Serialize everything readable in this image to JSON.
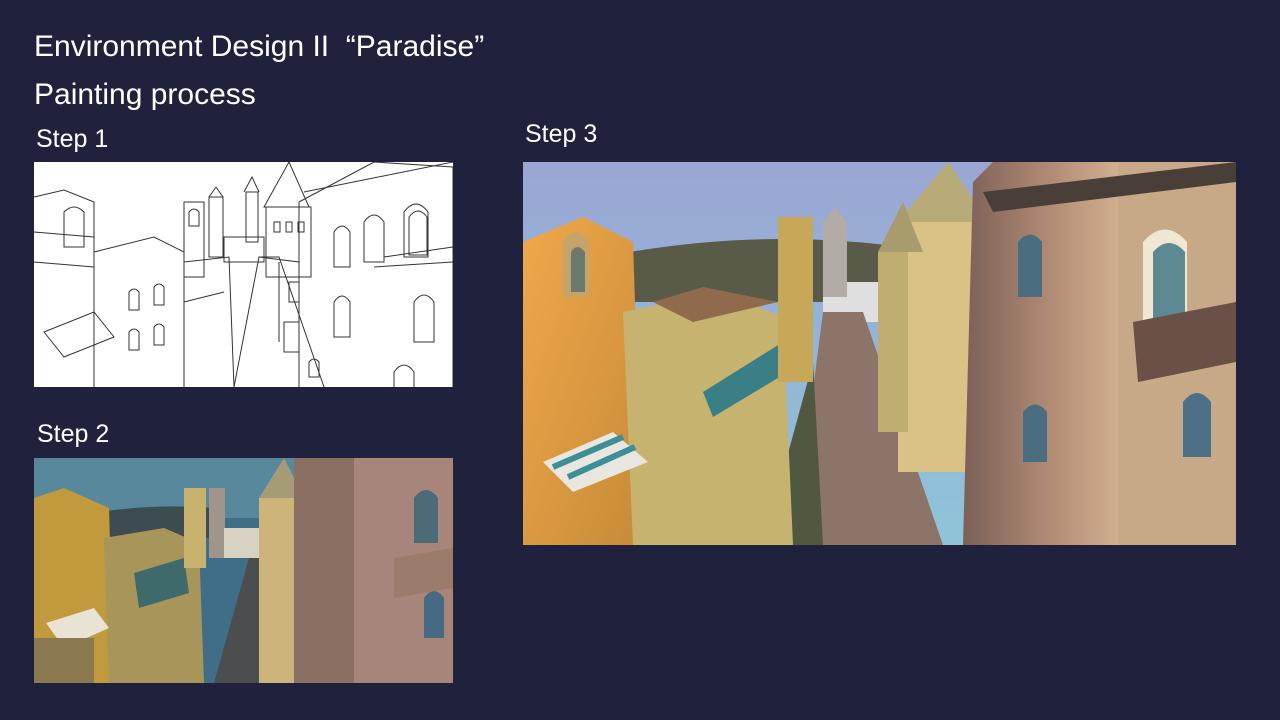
{
  "slide": {
    "title": "Environment Design II  “Paradise”",
    "subtitle": "Painting process"
  },
  "steps": [
    {
      "label": "Step 1"
    },
    {
      "label": "Step 2"
    },
    {
      "label": "Step 3"
    }
  ],
  "colors": {
    "background": "#20213d",
    "text": "#ffffff"
  }
}
